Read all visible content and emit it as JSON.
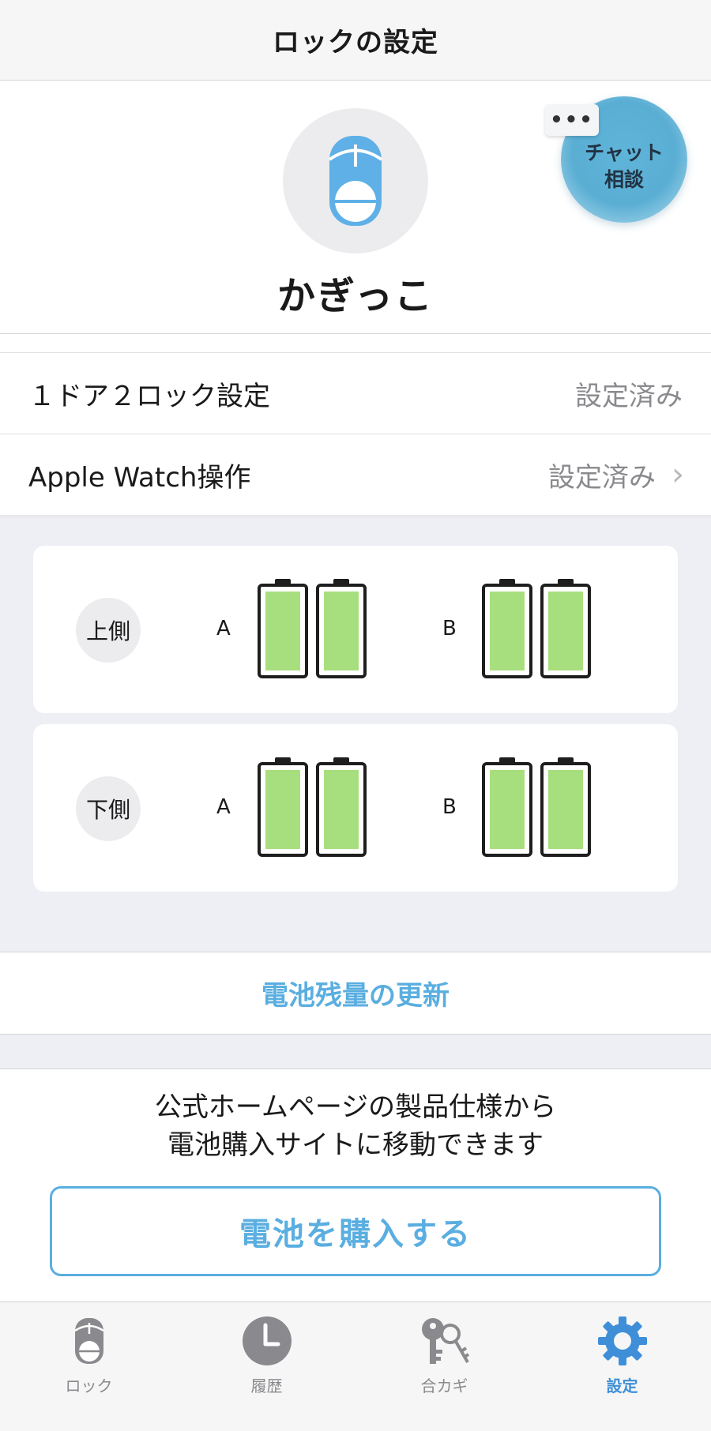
{
  "nav": {
    "title": "ロックの設定"
  },
  "header": {
    "device_name": "かぎっこ",
    "device_icon": "lock-device-icon"
  },
  "chat": {
    "label_line1": "チャット",
    "label_line2": "相談",
    "dots": "•••"
  },
  "settings": {
    "rows": [
      {
        "label": "１ドア２ロック設定",
        "value": "設定済み",
        "chevron": false
      },
      {
        "label": "Apple Watch操作",
        "value": "設定済み",
        "chevron": true,
        "chevron_glyph": "›"
      }
    ]
  },
  "battery": {
    "cards": [
      {
        "side": "上側",
        "groups": [
          {
            "label": "A",
            "levels": [
              1.0,
              1.0
            ]
          },
          {
            "label": "B",
            "levels": [
              1.0,
              1.0
            ]
          }
        ]
      },
      {
        "side": "下側",
        "groups": [
          {
            "label": "A",
            "levels": [
              1.0,
              1.0
            ]
          },
          {
            "label": "B",
            "levels": [
              1.0,
              1.0
            ]
          }
        ]
      }
    ],
    "fill_color": "#a8df7e"
  },
  "refresh": {
    "label": "電池残量の更新"
  },
  "purchase": {
    "desc_line1": "公式ホームページの製品仕様から",
    "desc_line2": "電池購入サイトに移動できます",
    "button_label": "電池を購入する"
  },
  "tabs": [
    {
      "label": "ロック",
      "icon": "lock-tab-icon",
      "active": false
    },
    {
      "label": "履歴",
      "icon": "clock-icon",
      "active": false
    },
    {
      "label": "合カギ",
      "icon": "keys-icon",
      "active": false
    },
    {
      "label": "設定",
      "icon": "gear-icon",
      "active": true
    }
  ],
  "colors": {
    "accent": "#5aaee0",
    "tab_active": "#3f8fd8",
    "section_bg": "#eeeff4"
  }
}
